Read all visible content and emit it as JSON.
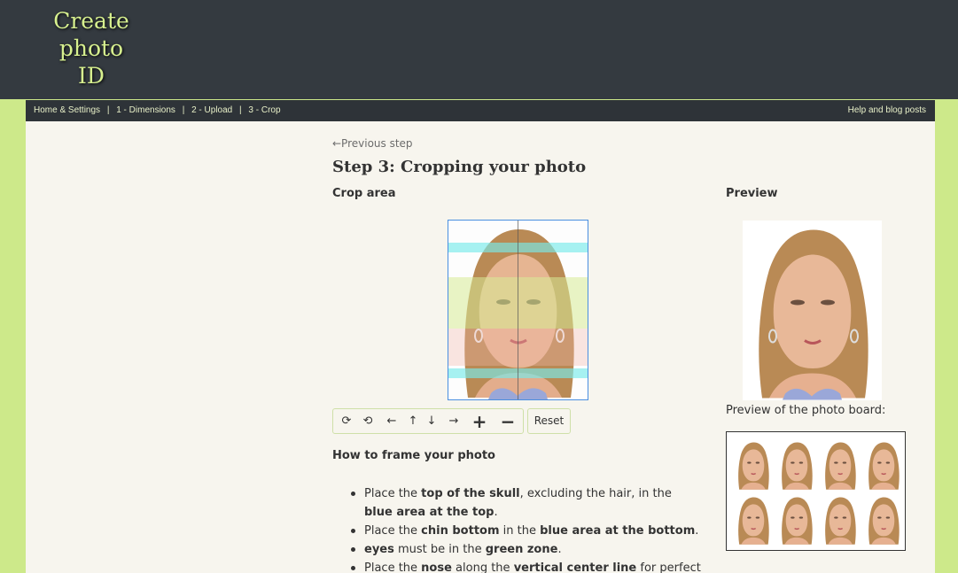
{
  "header": {
    "logo_line1": "Create photo",
    "logo_line2": "ID"
  },
  "nav": {
    "items": [
      {
        "label": "Home & Settings"
      },
      {
        "label": "1 - Dimensions"
      },
      {
        "label": "2 - Upload"
      },
      {
        "label": "3 - Crop"
      }
    ],
    "separator": "|",
    "help": "Help and blog posts"
  },
  "page": {
    "prev_link": "←Previous step",
    "title": "Step 3: Cropping your photo",
    "crop_heading": "Crop area",
    "preview_heading": "Preview",
    "board_caption": "Preview of the photo board:"
  },
  "toolbar": {
    "rotate_right": "⟳",
    "rotate_left": "⟲",
    "left": "←",
    "up": "↑",
    "down": "↓",
    "right": "→",
    "zoom_in": "+",
    "zoom_out": "−",
    "reset": "Reset"
  },
  "howto": {
    "heading": "How to frame your photo",
    "items": [
      [
        {
          "t": "Place the "
        },
        {
          "b": "top of the skull"
        },
        {
          "t": ", excluding the hair, in the "
        },
        {
          "b": "blue area at the top"
        },
        {
          "t": "."
        }
      ],
      [
        {
          "t": "Place the "
        },
        {
          "b": "chin bottom"
        },
        {
          "t": " in the "
        },
        {
          "b": "blue area at the bottom"
        },
        {
          "t": "."
        }
      ],
      [
        {
          "b": "eyes"
        },
        {
          "t": " must be in the "
        },
        {
          "b": "green zone"
        },
        {
          "t": "."
        }
      ],
      [
        {
          "t": "Place the "
        },
        {
          "b": "nose"
        },
        {
          "t": " along the "
        },
        {
          "b": "vertical center line"
        },
        {
          "t": " for perfect"
        }
      ]
    ]
  },
  "colors": {
    "header_bg": "#343a40",
    "page_bg": "#cde98a",
    "content_bg": "#f7f5ee",
    "guide_blue": "#78ebeb",
    "guide_green": "#d7eb96",
    "logo": "#d7f08f"
  },
  "icons": {
    "face_photo": "portrait-photo",
    "board_photos": 8
  }
}
